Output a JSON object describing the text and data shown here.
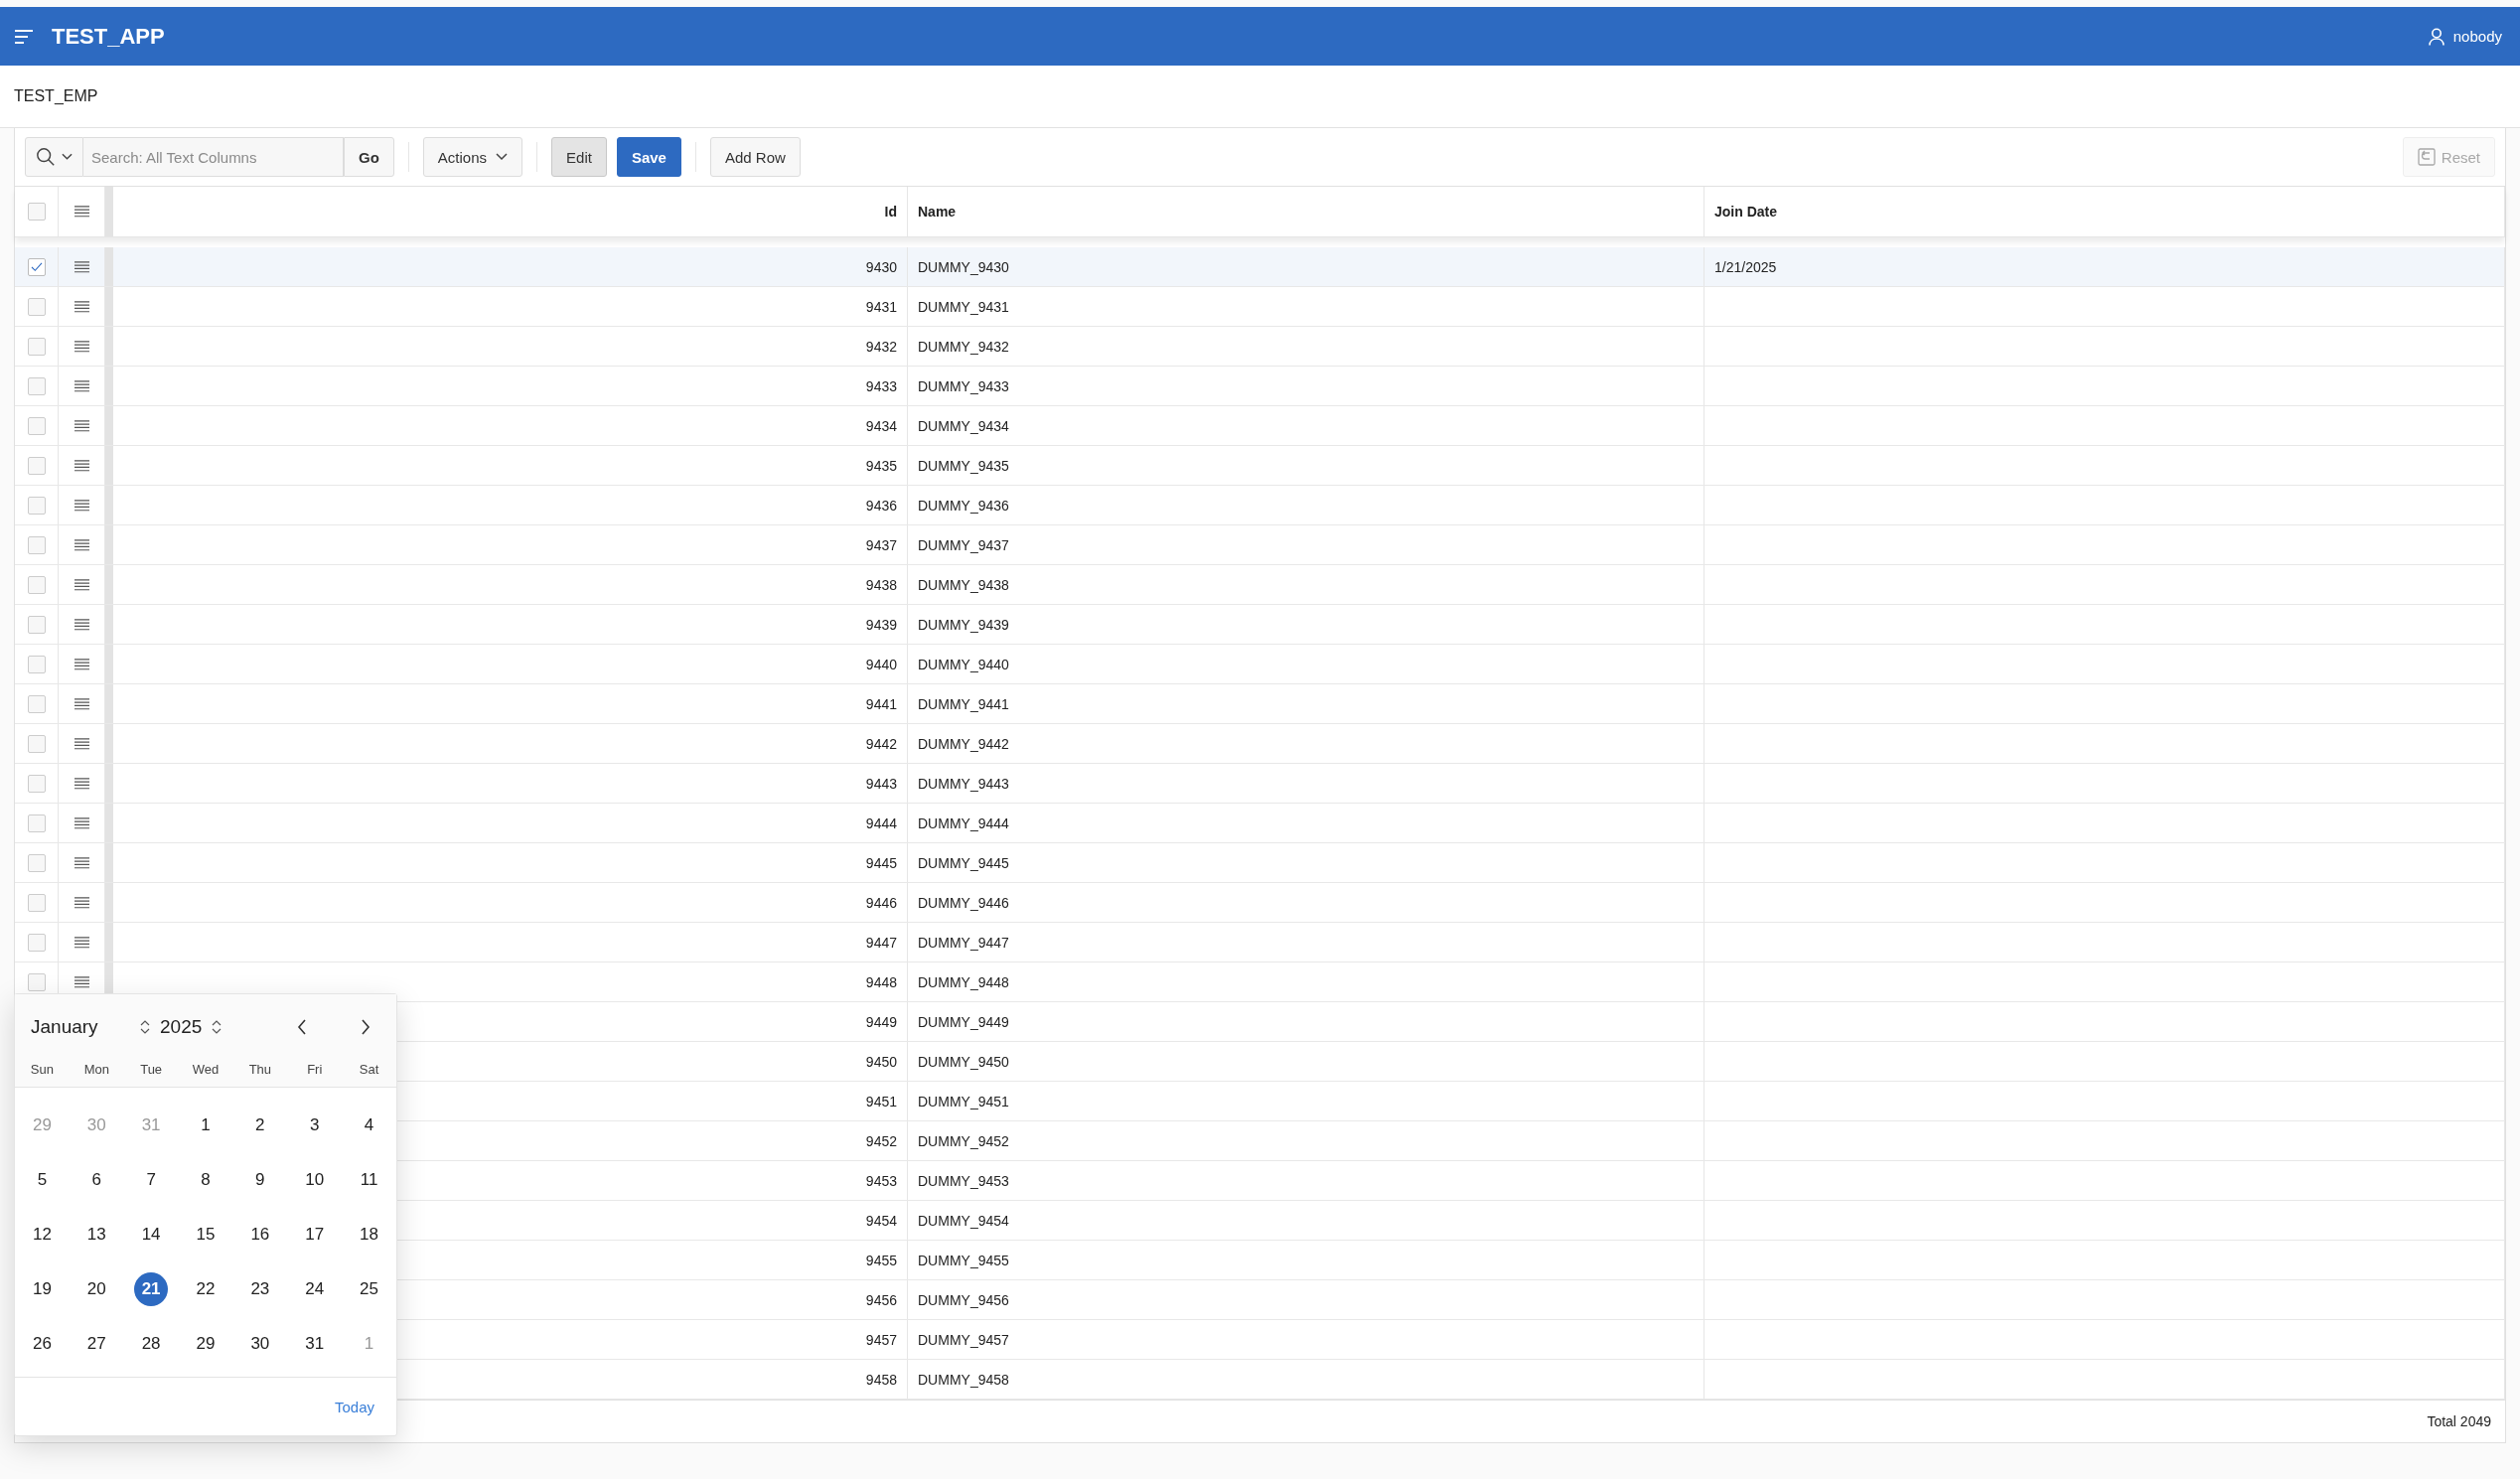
{
  "header": {
    "app_title": "TEST_APP",
    "user": "nobody"
  },
  "region_title": "TEST_EMP",
  "toolbar": {
    "search_placeholder": "Search: All Text Columns",
    "go": "Go",
    "actions": "Actions",
    "edit": {
      "label": "Edit",
      "pressed": true
    },
    "save": "Save",
    "add_row": "Add Row",
    "reset": {
      "label": "Reset",
      "disabled": true
    }
  },
  "table": {
    "select_all_checked": false,
    "columns": [
      {
        "label": "Id",
        "kind": "number"
      },
      {
        "label": "Name",
        "kind": "text"
      },
      {
        "label": "Join Date",
        "kind": "text"
      }
    ],
    "rows": [
      {
        "selected": true,
        "cells": [
          "9430",
          "DUMMY_9430",
          "1/21/2025"
        ]
      },
      {
        "selected": false,
        "cells": [
          "9431",
          "DUMMY_9431",
          ""
        ]
      },
      {
        "selected": false,
        "cells": [
          "9432",
          "DUMMY_9432",
          ""
        ]
      },
      {
        "selected": false,
        "cells": [
          "9433",
          "DUMMY_9433",
          ""
        ]
      },
      {
        "selected": false,
        "cells": [
          "9434",
          "DUMMY_9434",
          ""
        ]
      },
      {
        "selected": false,
        "cells": [
          "9435",
          "DUMMY_9435",
          ""
        ]
      },
      {
        "selected": false,
        "cells": [
          "9436",
          "DUMMY_9436",
          ""
        ]
      },
      {
        "selected": false,
        "cells": [
          "9437",
          "DUMMY_9437",
          ""
        ]
      },
      {
        "selected": false,
        "cells": [
          "9438",
          "DUMMY_9438",
          ""
        ]
      },
      {
        "selected": false,
        "cells": [
          "9439",
          "DUMMY_9439",
          ""
        ]
      },
      {
        "selected": false,
        "cells": [
          "9440",
          "DUMMY_9440",
          ""
        ]
      },
      {
        "selected": false,
        "cells": [
          "9441",
          "DUMMY_9441",
          ""
        ]
      },
      {
        "selected": false,
        "cells": [
          "9442",
          "DUMMY_9442",
          ""
        ]
      },
      {
        "selected": false,
        "cells": [
          "9443",
          "DUMMY_9443",
          ""
        ]
      },
      {
        "selected": false,
        "cells": [
          "9444",
          "DUMMY_9444",
          ""
        ]
      },
      {
        "selected": false,
        "cells": [
          "9445",
          "DUMMY_9445",
          ""
        ]
      },
      {
        "selected": false,
        "cells": [
          "9446",
          "DUMMY_9446",
          ""
        ]
      },
      {
        "selected": false,
        "cells": [
          "9447",
          "DUMMY_9447",
          ""
        ]
      },
      {
        "selected": false,
        "cells": [
          "9448",
          "DUMMY_9448",
          ""
        ]
      },
      {
        "cells": [
          "9449",
          "DUMMY_9449",
          ""
        ]
      },
      {
        "cells": [
          "9450",
          "DUMMY_9450",
          ""
        ]
      },
      {
        "cells": [
          "9451",
          "DUMMY_9451",
          ""
        ]
      },
      {
        "cells": [
          "9452",
          "DUMMY_9452",
          ""
        ]
      },
      {
        "cells": [
          "9453",
          "DUMMY_9453",
          ""
        ]
      },
      {
        "cells": [
          "9454",
          "DUMMY_9454",
          ""
        ]
      },
      {
        "cells": [
          "9455",
          "DUMMY_9455",
          ""
        ]
      },
      {
        "cells": [
          "9456",
          "DUMMY_9456",
          ""
        ]
      },
      {
        "cells": [
          "9457",
          "DUMMY_9457",
          ""
        ]
      },
      {
        "cells": [
          "9458",
          "DUMMY_9458",
          ""
        ]
      }
    ],
    "total": "Total 2049"
  },
  "date_picker": {
    "month": "January",
    "year": "2025",
    "weekdays": [
      "Sun",
      "Mon",
      "Tue",
      "Wed",
      "Thu",
      "Fri",
      "Sat"
    ],
    "weeks": [
      [
        {
          "day": "29",
          "outside": true,
          "selected": false
        },
        {
          "day": "30",
          "outside": true,
          "selected": false
        },
        {
          "day": "31",
          "outside": true,
          "selected": false
        },
        {
          "day": "1",
          "outside": false,
          "selected": false
        },
        {
          "day": "2",
          "outside": false,
          "selected": false
        },
        {
          "day": "3",
          "outside": false,
          "selected": false
        },
        {
          "day": "4",
          "outside": false,
          "selected": false
        }
      ],
      [
        {
          "day": "5",
          "outside": false,
          "selected": false
        },
        {
          "day": "6",
          "outside": false,
          "selected": false
        },
        {
          "day": "7",
          "outside": false,
          "selected": false
        },
        {
          "day": "8",
          "outside": false,
          "selected": false
        },
        {
          "day": "9",
          "outside": false,
          "selected": false
        },
        {
          "day": "10",
          "outside": false,
          "selected": false
        },
        {
          "day": "11",
          "outside": false,
          "selected": false
        }
      ],
      [
        {
          "day": "12",
          "outside": false,
          "selected": false
        },
        {
          "day": "13",
          "outside": false,
          "selected": false
        },
        {
          "day": "14",
          "outside": false,
          "selected": false
        },
        {
          "day": "15",
          "outside": false,
          "selected": false
        },
        {
          "day": "16",
          "outside": false,
          "selected": false
        },
        {
          "day": "17",
          "outside": false,
          "selected": false
        },
        {
          "day": "18",
          "outside": false,
          "selected": false
        }
      ],
      [
        {
          "day": "19",
          "outside": false,
          "selected": false
        },
        {
          "day": "20",
          "outside": false,
          "selected": false
        },
        {
          "day": "21",
          "outside": false,
          "selected": true
        },
        {
          "day": "22",
          "outside": false,
          "selected": false
        },
        {
          "day": "23",
          "outside": false,
          "selected": false
        },
        {
          "day": "24",
          "outside": false,
          "selected": false
        },
        {
          "day": "25",
          "outside": false,
          "selected": false
        }
      ],
      [
        {
          "day": "26",
          "outside": false,
          "selected": false
        },
        {
          "day": "27",
          "outside": false,
          "selected": false
        },
        {
          "day": "28",
          "outside": false,
          "selected": false
        },
        {
          "day": "29",
          "outside": false,
          "selected": false
        },
        {
          "day": "30",
          "outside": false,
          "selected": false
        },
        {
          "day": "31",
          "outside": false,
          "selected": false
        },
        {
          "day": "1",
          "outside": true,
          "selected": false
        }
      ]
    ],
    "today": "Today"
  }
}
